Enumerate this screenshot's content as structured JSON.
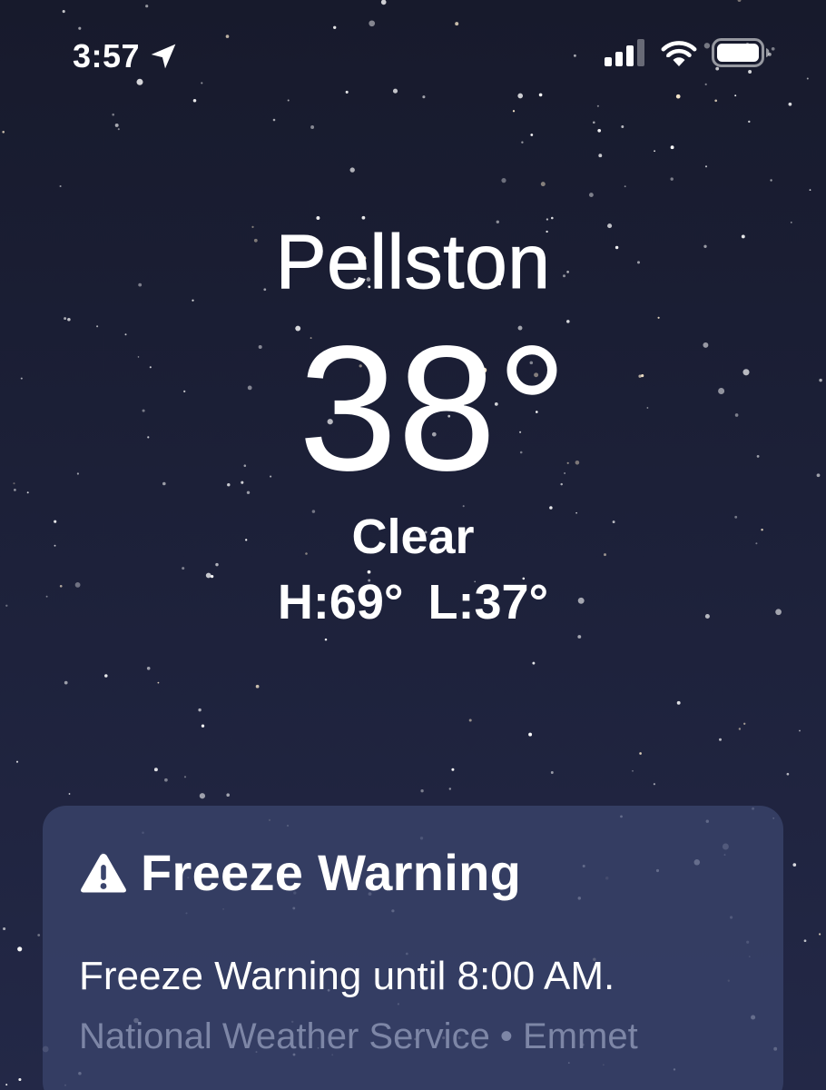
{
  "status_bar": {
    "time": "3:57",
    "icons": [
      "location-arrow-icon",
      "cellular-signal-icon",
      "wifi-icon",
      "battery-icon"
    ]
  },
  "weather": {
    "city": "Pellston",
    "temperature": "38°",
    "condition": "Clear",
    "high_low": "H:69° L:37°"
  },
  "alert": {
    "icon": "warning-triangle-icon",
    "title": "Freeze Warning",
    "message": "Freeze Warning until 8:00 AM.",
    "source": "National Weather Service • Emmet"
  },
  "colors": {
    "background_top": "#171a2c",
    "background_bottom": "#232847",
    "card_background": "#3a446c",
    "secondary_text": "#7d86a6"
  }
}
